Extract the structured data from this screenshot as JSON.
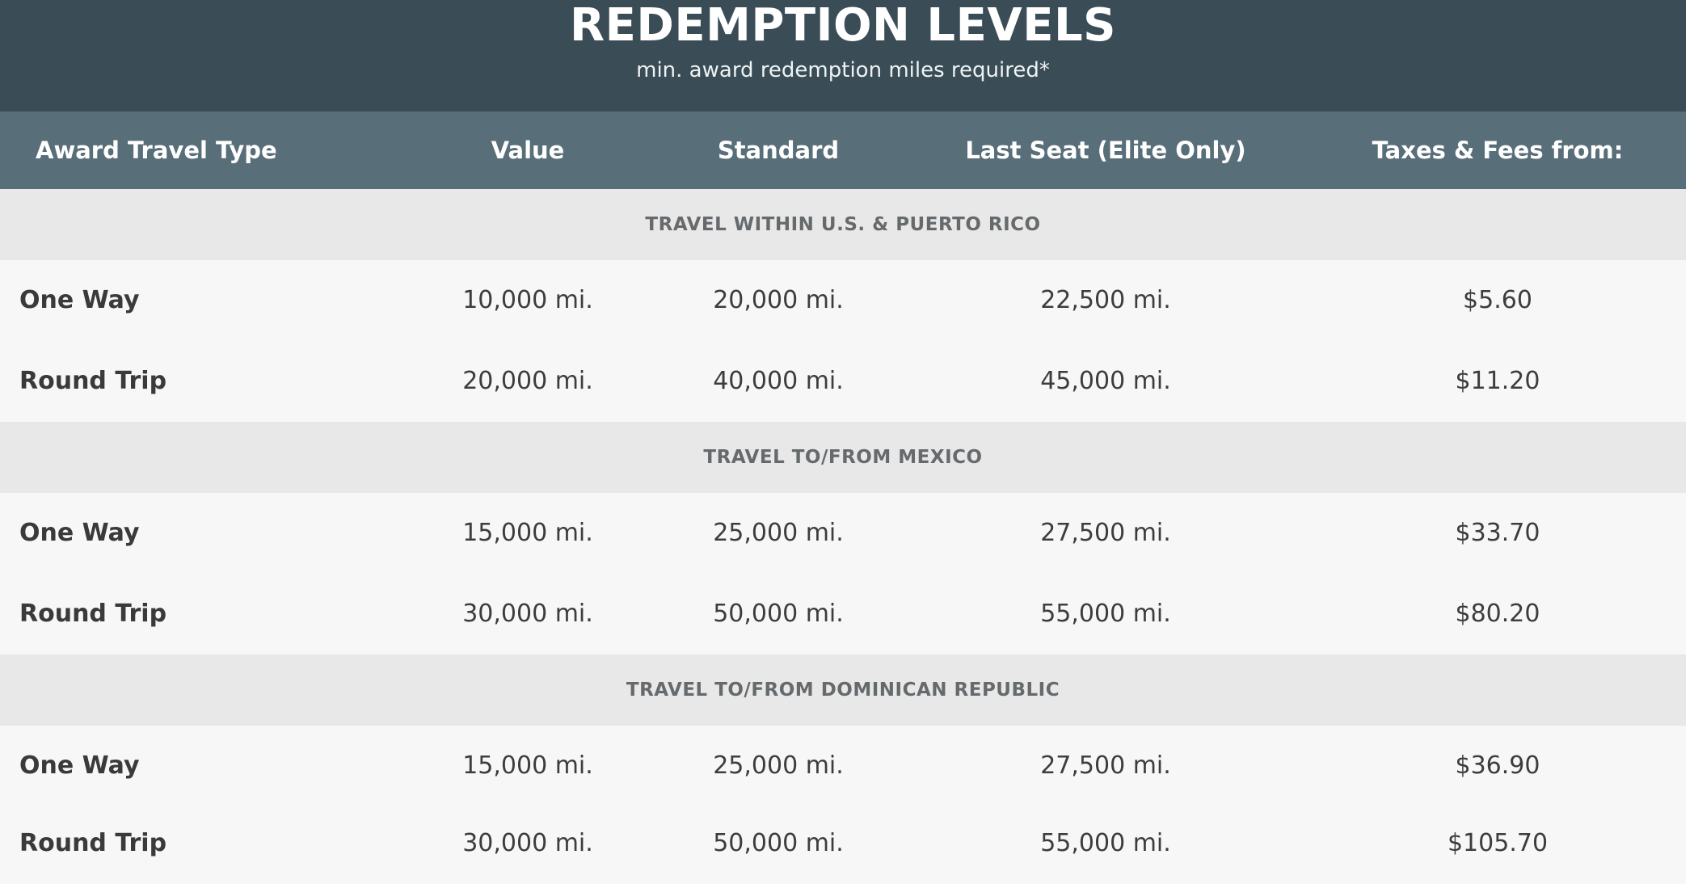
{
  "banner": {
    "title": "REDEMPTION LEVELS",
    "subtitle": "min. award redemption miles required*"
  },
  "columns": [
    "Award Travel Type",
    "Value",
    "Standard",
    "Last Seat (Elite Only)",
    "Taxes & Fees from:"
  ],
  "sections": [
    {
      "title": "TRAVEL WITHIN U.S. & PUERTO RICO",
      "rows": [
        {
          "type": "One Way",
          "value": "10,000 mi.",
          "standard": "20,000 mi.",
          "last_seat": "22,500 mi.",
          "taxes": "$5.60"
        },
        {
          "type": "Round Trip",
          "value": "20,000 mi.",
          "standard": "40,000 mi.",
          "last_seat": "45,000 mi.",
          "taxes": "$11.20"
        }
      ]
    },
    {
      "title": "TRAVEL TO/FROM MEXICO",
      "rows": [
        {
          "type": "One Way",
          "value": "15,000 mi.",
          "standard": "25,000 mi.",
          "last_seat": "27,500 mi.",
          "taxes": "$33.70"
        },
        {
          "type": "Round Trip",
          "value": "30,000 mi.",
          "standard": "50,000 mi.",
          "last_seat": "55,000 mi.",
          "taxes": "$80.20"
        }
      ]
    },
    {
      "title": "TRAVEL TO/FROM DOMINICAN REPUBLIC",
      "rows": [
        {
          "type": "One Way",
          "value": "15,000 mi.",
          "standard": "25,000 mi.",
          "last_seat": "27,500 mi.",
          "taxes": "$36.90"
        },
        {
          "type": "Round Trip",
          "value": "30,000 mi.",
          "standard": "50,000 mi.",
          "last_seat": "55,000 mi.",
          "taxes": "$105.70"
        }
      ]
    }
  ]
}
